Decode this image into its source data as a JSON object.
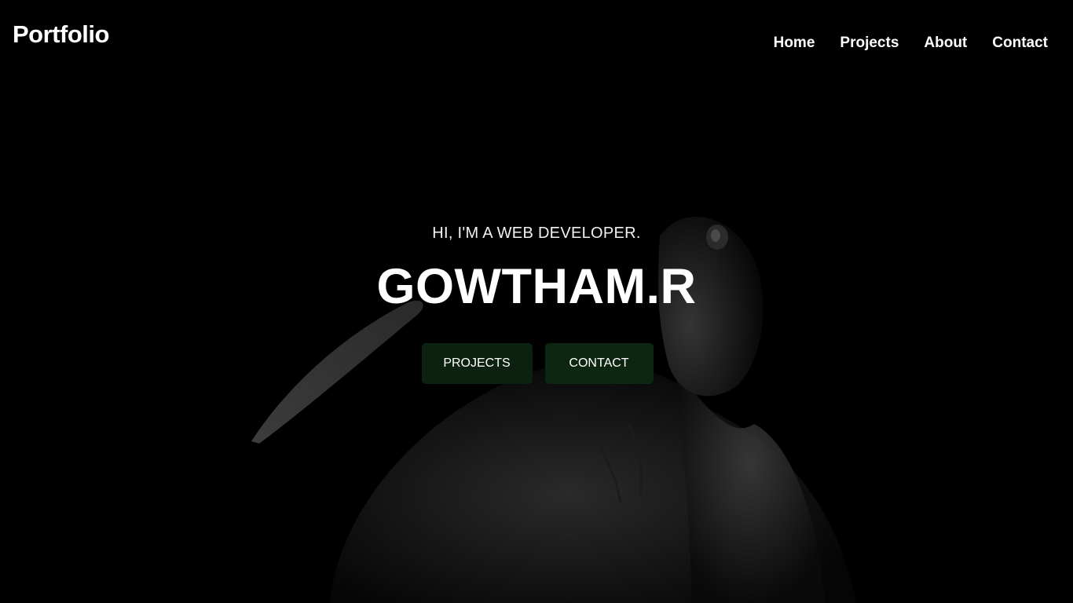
{
  "header": {
    "logo": "Portfolio",
    "nav": [
      {
        "label": "Home"
      },
      {
        "label": "Projects"
      },
      {
        "label": "About"
      },
      {
        "label": "Contact"
      }
    ]
  },
  "hero": {
    "tagline": "HI, I'M A WEB DEVELOPER.",
    "name": "GOWTHAM.R",
    "buttons": {
      "projects": "PROJECTS",
      "contact": "CONTACT"
    }
  },
  "colors": {
    "background": "#000000",
    "text": "#ffffff",
    "button_background": "#0c2110"
  }
}
